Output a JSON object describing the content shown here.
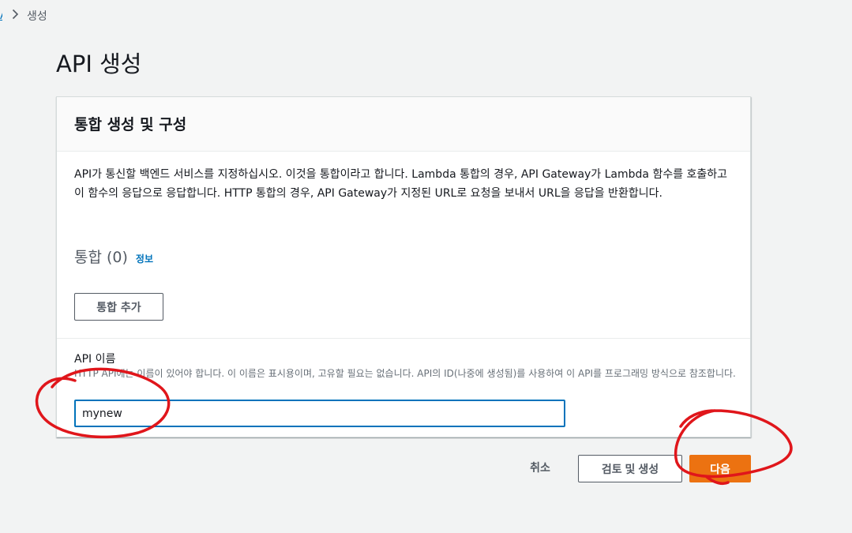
{
  "breadcrumb": {
    "parent_label": "API",
    "separator_icon": "chevron-right-icon",
    "current": "생성"
  },
  "page": {
    "title": "API 생성"
  },
  "panel": {
    "title": "통합 생성 및 구성",
    "description": "API가 통신할 백엔드 서비스를 지정하십시오. 이것을 통합이라고 합니다. Lambda 통합의 경우, API Gateway가 Lambda 함수를 호출하고 이 함수의 응답으로 응답합니다. HTTP 통합의 경우, API Gateway가 지정된 URL로 요청을 보내서 URL을 응답을 반환합니다.",
    "integrations_title": "통합 (0)",
    "info_label": "정보",
    "add_integration_label": "통합 추가"
  },
  "api_name": {
    "label": "API 이름",
    "description": "HTTP API에는 이름이 있어야 합니다. 이 이름은 표시용이며, 고유할 필요는 없습니다. API의 ID(나중에 생성됨)를 사용하여 이 API를 프로그래밍 방식으로 참조합니다.",
    "value": "mynew"
  },
  "footer": {
    "cancel_label": "취소",
    "review_label": "검토 및 생성",
    "next_label": "다음"
  },
  "colors": {
    "accent_blue": "#0073bb",
    "primary_orange": "#ec7211",
    "annotation_red": "#e0161b"
  }
}
